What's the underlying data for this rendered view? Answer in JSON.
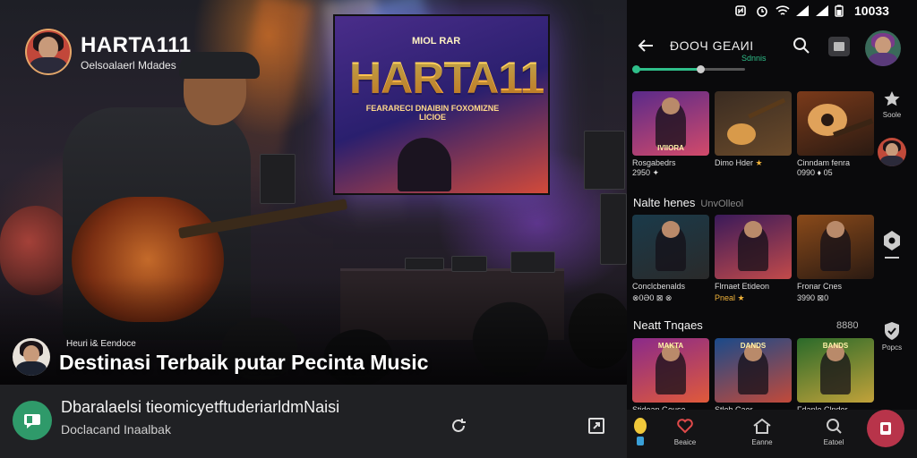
{
  "hero": {
    "brand_title": "HARTA111",
    "brand_subtitle": "Oelsoalaerl Mdades",
    "screen_small": "MIOL RAR",
    "screen_title": "HARTA11",
    "screen_sub": "FEARARECI DNAIBIN FOXOMIZNE LICIOE",
    "caption_small": "Heuri i& Eendoce",
    "caption_big": "Destinasi Terbaik putar Pecinta Music"
  },
  "left_bar": {
    "title": "Dbaralaelsi tieomicyetftuderiarldmNaisi",
    "subtitle": "Doclacand Inaalbak",
    "icon": "chat-bubble-icon",
    "buttons": [
      "refresh-icon",
      "share-icon"
    ]
  },
  "status_bar": {
    "time": "10033",
    "icons": [
      "nfc-icon",
      "alarm-icon",
      "wifi-icon",
      "signal-icon",
      "battery-icon"
    ]
  },
  "app_bar": {
    "title": "ÐOOЧ GEAИI",
    "slider_label": "Sdnnis",
    "slider_value": 0.6,
    "icons": [
      "back-arrow-icon",
      "search-icon",
      "cast-icon",
      "profile-avatar"
    ]
  },
  "row1": {
    "cards": [
      {
        "label": "Rosgabedrs",
        "suffix": "",
        "colors": [
          "#5a2a8a",
          "#d24a6a"
        ],
        "caption": "IVIIORA"
      },
      {
        "label": "Dimo Hder",
        "suffix": "★",
        "colors": [
          "#3a2c22",
          "#6a4a2a"
        ],
        "caption": ""
      },
      {
        "label": "Cinndam fenra",
        "suffix": "",
        "colors": [
          "#7a3a1a",
          "#2a1a12"
        ],
        "caption": ""
      }
    ],
    "sublabels": [
      "2950 ✦",
      "",
      "0990 ♦ 05"
    ]
  },
  "section2": {
    "title": "Nalte henes",
    "subtitle": "UnvOlleol",
    "cards": [
      {
        "label": "Conclcbenalds",
        "sub": "⊗0Ə0 ⊠ ⊗",
        "colors": [
          "#1a3a4a",
          "#2a2a2a"
        ],
        "caption": ""
      },
      {
        "label": "Flrnaet Etideon",
        "sub": "Pneal ★",
        "colors": [
          "#3a1a5a",
          "#c24a4a"
        ],
        "caption": ""
      },
      {
        "label": "Fronar Cnes",
        "sub": "3990 ⊠0",
        "colors": [
          "#8a4a1a",
          "#2a1a12"
        ],
        "caption": ""
      }
    ]
  },
  "section3": {
    "title": "Neatt Tnqaes",
    "more": "8880",
    "cards": [
      {
        "label": "Stidoan Gouse",
        "colors": [
          "#8a2a8a",
          "#e05a3a"
        ],
        "caption": "MAKTA"
      },
      {
        "label": "Stleh Caer",
        "colors": [
          "#1a4a8a",
          "#c24a3a"
        ],
        "caption": "DANDS"
      },
      {
        "label": "Fdanle Clndor",
        "colors": [
          "#2a6a2a",
          "#c2a23a"
        ],
        "caption": "BANDS"
      }
    ]
  },
  "side_column": [
    {
      "label": "Soole",
      "icon": "star-badge-icon"
    },
    {
      "label": "",
      "icon": "user-avatar"
    },
    {
      "label": "",
      "icon": "settings-tag-icon"
    },
    {
      "label": "Popcs",
      "icon": "shield-icon"
    }
  ],
  "bottom_nav": [
    {
      "label": "",
      "icon": "bulb-icon"
    },
    {
      "label": "Beaice",
      "icon": "heart-icon"
    },
    {
      "label": "Eanne",
      "icon": "home-icon"
    },
    {
      "label": "Eatoel",
      "icon": "search-icon"
    }
  ],
  "fab_icon": "trash-icon",
  "colors": {
    "accent_green": "#2fbf8a",
    "accent_gold": "#ffb84a",
    "fab": "#b8344a"
  }
}
